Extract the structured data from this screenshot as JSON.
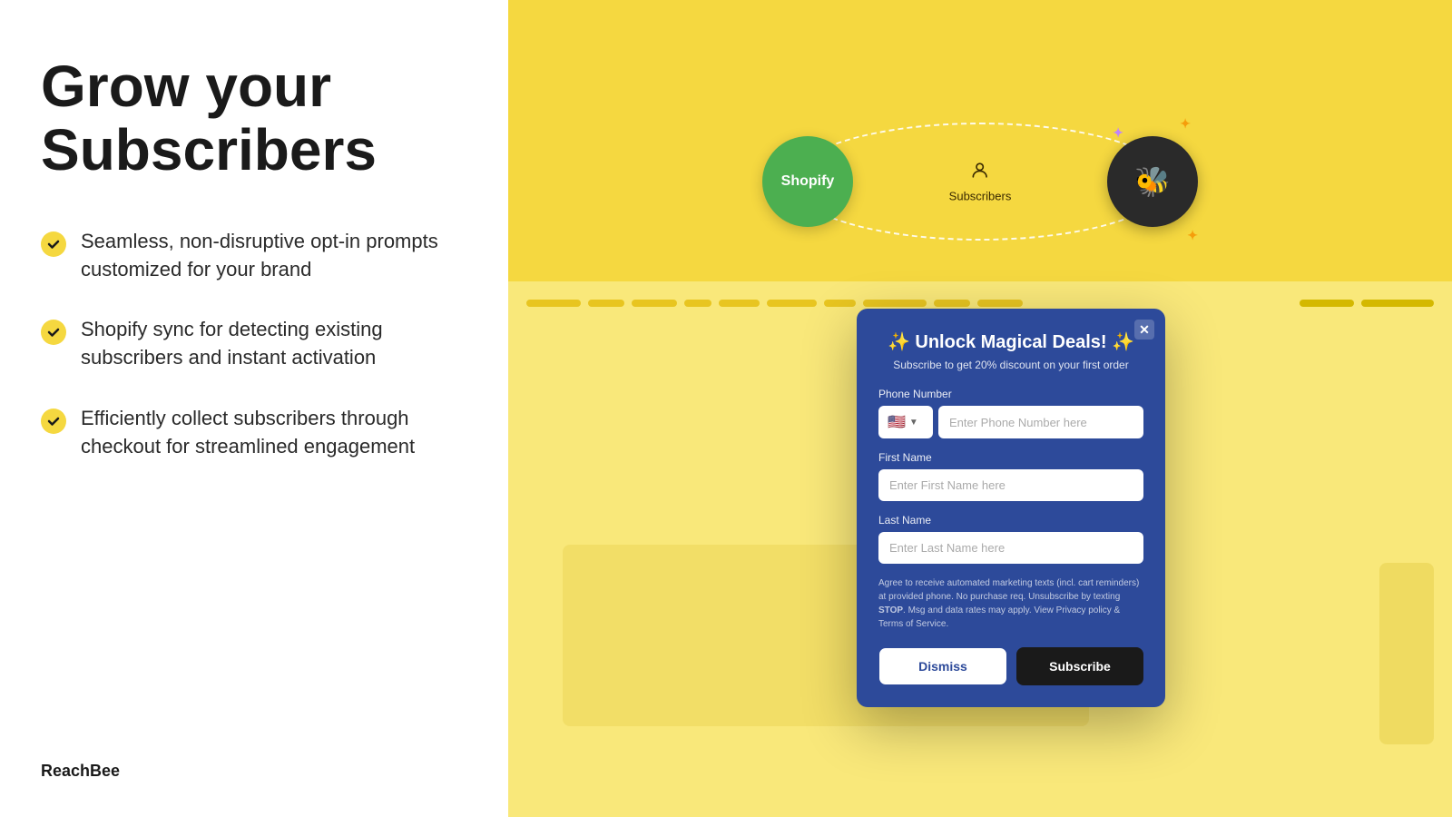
{
  "left": {
    "title_line1": "Grow your",
    "title_line2": "Subscribers",
    "features": [
      {
        "id": "feature-1",
        "text": "Seamless, non-disruptive opt-in prompts customized for your brand"
      },
      {
        "id": "feature-2",
        "text": "Shopify sync for detecting existing subscribers and instant activation"
      },
      {
        "id": "feature-3",
        "text": "Efficiently collect subscribers through checkout for streamlined engagement"
      }
    ],
    "brand": "ReachBee"
  },
  "diagram": {
    "shopify_label": "Shopify",
    "subscribers_label": "Subscribers",
    "sparkles": [
      "✦",
      "✦",
      "✦"
    ]
  },
  "modal": {
    "title": "✨ Unlock Magical Deals! ✨",
    "subtitle": "Subscribe to get 20% discount on your first order",
    "phone_label": "Phone Number",
    "phone_placeholder": "Enter Phone Number here",
    "first_name_label": "First Name",
    "first_name_placeholder": "Enter First Name here",
    "last_name_label": "Last Name",
    "last_name_placeholder": "Enter Last Name here",
    "consent_text": "Agree to receive automated marketing texts (incl. cart reminders) at provided phone. No purchase req. Unsubscribe by texting ",
    "consent_stop": "STOP",
    "consent_text2": ". Msg and data rates may apply. View Privacy policy & Terms of Service.",
    "dismiss_label": "Dismiss",
    "subscribe_label": "Subscribe",
    "flag_emoji": "🇺🇸",
    "close_symbol": "✕"
  }
}
